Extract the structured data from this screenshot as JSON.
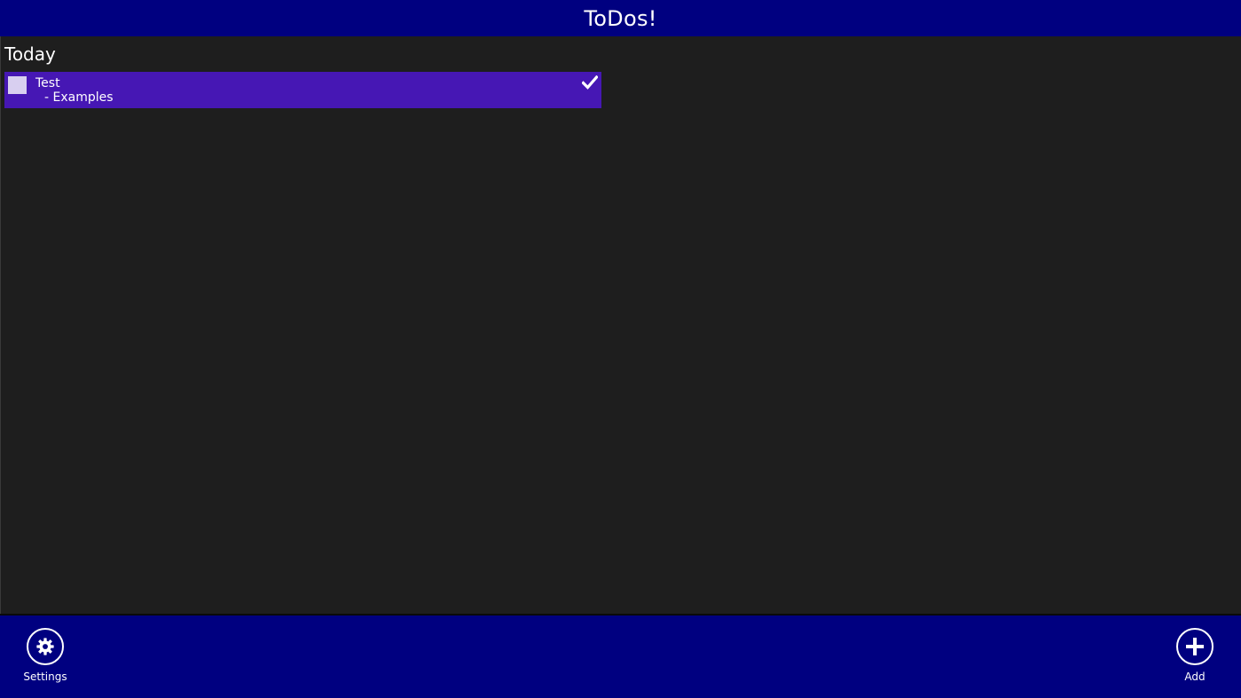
{
  "header": {
    "title": "ToDos!"
  },
  "main": {
    "section_title": "Today",
    "items": [
      {
        "title": "Test",
        "subtitle": "- Examples",
        "completed": true
      }
    ]
  },
  "appbar": {
    "settings_label": "Settings",
    "add_label": "Add"
  },
  "icons": {
    "settings": "gear-icon",
    "add": "plus-icon",
    "check": "checkmark-icon"
  },
  "colors": {
    "header_bg": "#000080",
    "appbar_bg": "#000080",
    "page_bg": "#1e1e1e",
    "item_bg": "#4617b4",
    "checkbox_fill": "#d8cff0",
    "text": "#ffffff"
  }
}
